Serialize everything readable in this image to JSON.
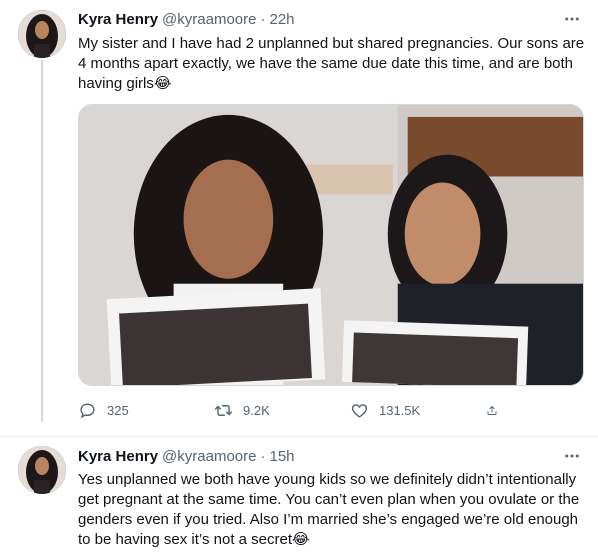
{
  "tweets": [
    {
      "author": {
        "name": "Kyra Henry",
        "handle": "@kyraamoore",
        "avatar_icon": "profile-photo"
      },
      "separator": "·",
      "time": "22h",
      "text": "My sister and I have had 2 unplanned but shared pregnancies. Our sons are\n4 months apart exactly, we have the same due date this time, and are both\nhaving girls😂",
      "actions": {
        "reply_count": "325",
        "retweet_count": "9.2K",
        "like_count": "131.5K"
      }
    },
    {
      "author": {
        "name": "Kyra Henry",
        "handle": "@kyraamoore",
        "avatar_icon": "profile-photo"
      },
      "separator": "·",
      "time": "15h",
      "text": "Yes unplanned we both have young kids so we definitely didn’t intentionally\nget pregnant at the same time. You can’t even plan when you ovulate or the\ngenders even if you tried. Also I’m married she’s engaged we’re old enough\nto be having sex it’s not a secret😂"
    }
  ],
  "icons": {
    "more": "more-horizontal-icon",
    "reply": "reply-icon",
    "retweet": "retweet-icon",
    "like": "heart-icon",
    "share": "share-icon"
  },
  "colors": {
    "secondary_text": "#536471",
    "border": "#ebeef0",
    "thread_line": "#cfd9de"
  }
}
